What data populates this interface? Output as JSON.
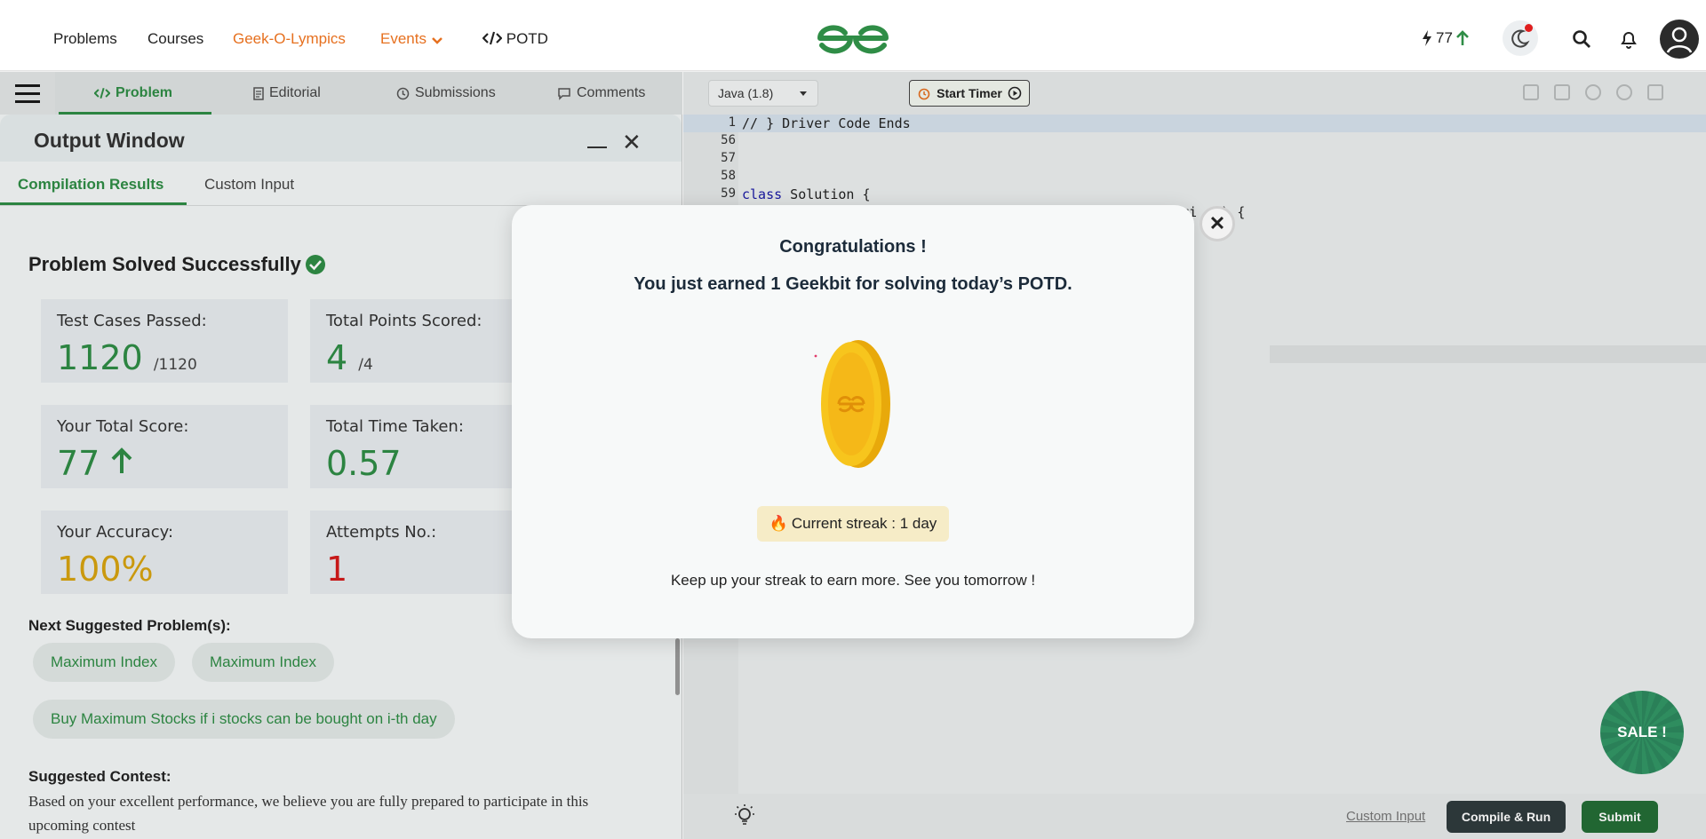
{
  "nav": {
    "items": [
      "Problems",
      "Courses",
      "Geek-O-Lympics",
      "Events",
      "POTD"
    ],
    "score": "77"
  },
  "left_tabs": [
    "Problem",
    "Editorial",
    "Submissions",
    "Comments"
  ],
  "output": {
    "title": "Output Window",
    "subtabs": [
      "Compilation Results",
      "Custom Input"
    ],
    "status": "Problem Solved Successfully",
    "cards": [
      {
        "label": "Test Cases Passed:",
        "value": "1120",
        "suffix": "/1120"
      },
      {
        "label": "Total Points Scored:",
        "value": "4",
        "suffix": "/4"
      },
      {
        "label": "Your Total Score:",
        "value": "77"
      },
      {
        "label": "Total Time Taken:",
        "value": "0.57"
      },
      {
        "label": "Your Accuracy:",
        "value": "100%"
      },
      {
        "label": "Attempts No.:",
        "value": "1"
      }
    ],
    "suggested_heading": "Next Suggested Problem(s):",
    "suggested": [
      "Maximum Index",
      "Maximum Index",
      "Buy Maximum Stocks if i stocks can be bought on i-th day"
    ],
    "contest_heading": "Suggested Contest:",
    "contest_text": "Based on your excellent performance, we believe you are fully prepared to participate in this upcoming contest"
  },
  "editor": {
    "language": "Java (1.8)",
    "timer_label": "Start Timer",
    "lines": [
      {
        "num": "1",
        "code": "// } Driver Code Ends"
      },
      {
        "num": "56",
        "code": ""
      },
      {
        "num": "57",
        "code": ""
      },
      {
        "num": "58",
        "code": ""
      },
      {
        "num": "59",
        "code_kw": "class",
        "code_rest": " Solution {"
      }
    ],
    "partial_right": "ri   ) {",
    "custom_input": "Custom Input",
    "compile_label": "Compile & Run",
    "submit_label": "Submit",
    "sale_label": "SALE !"
  },
  "modal": {
    "title": "Congratulations !",
    "subtitle": "You just earned 1 Geekbit for solving today’s POTD.",
    "streak": "Current streak : 1 day",
    "footer": "Keep up your streak to earn more. See you tomorrow !"
  }
}
